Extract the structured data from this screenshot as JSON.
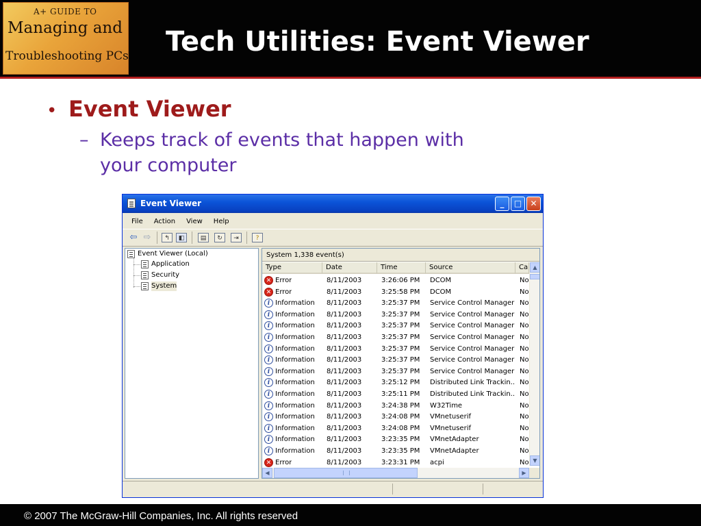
{
  "slide": {
    "title": "Tech Utilities: Event Viewer",
    "logo": {
      "line1": "A+ GUIDE TO",
      "line2": "Managing and",
      "line3": "Troubleshooting PCs"
    },
    "bullet": "Event Viewer",
    "sub_bullet_line1": "Keeps track of events that happen with",
    "sub_bullet_line2": "your computer",
    "footer": "© 2007 The McGraw-Hill Companies, Inc. All rights reserved"
  },
  "window": {
    "title": "Event Viewer",
    "menu": [
      "File",
      "Action",
      "View",
      "Help"
    ],
    "tree": {
      "root": "Event Viewer (Local)",
      "children": [
        "Application",
        "Security",
        "System"
      ]
    },
    "list": {
      "header": "System   1,338 event(s)",
      "columns": [
        "Type",
        "Date",
        "Time",
        "Source",
        "Ca"
      ],
      "rows": [
        {
          "type": "Error",
          "icon": "error-icon",
          "date": "8/11/2003",
          "time": "3:26:06 PM",
          "source": "DCOM",
          "cat": "No"
        },
        {
          "type": "Error",
          "icon": "error-icon",
          "date": "8/11/2003",
          "time": "3:25:58 PM",
          "source": "DCOM",
          "cat": "No"
        },
        {
          "type": "Information",
          "icon": "info-icon",
          "date": "8/11/2003",
          "time": "3:25:37 PM",
          "source": "Service Control Manager",
          "cat": "No"
        },
        {
          "type": "Information",
          "icon": "info-icon",
          "date": "8/11/2003",
          "time": "3:25:37 PM",
          "source": "Service Control Manager",
          "cat": "No"
        },
        {
          "type": "Information",
          "icon": "info-icon",
          "date": "8/11/2003",
          "time": "3:25:37 PM",
          "source": "Service Control Manager",
          "cat": "No"
        },
        {
          "type": "Information",
          "icon": "info-icon",
          "date": "8/11/2003",
          "time": "3:25:37 PM",
          "source": "Service Control Manager",
          "cat": "No"
        },
        {
          "type": "Information",
          "icon": "info-icon",
          "date": "8/11/2003",
          "time": "3:25:37 PM",
          "source": "Service Control Manager",
          "cat": "No"
        },
        {
          "type": "Information",
          "icon": "info-icon",
          "date": "8/11/2003",
          "time": "3:25:37 PM",
          "source": "Service Control Manager",
          "cat": "No"
        },
        {
          "type": "Information",
          "icon": "info-icon",
          "date": "8/11/2003",
          "time": "3:25:37 PM",
          "source": "Service Control Manager",
          "cat": "No"
        },
        {
          "type": "Information",
          "icon": "info-icon",
          "date": "8/11/2003",
          "time": "3:25:12 PM",
          "source": "Distributed Link Trackin...",
          "cat": "No"
        },
        {
          "type": "Information",
          "icon": "info-icon",
          "date": "8/11/2003",
          "time": "3:25:11 PM",
          "source": "Distributed Link Trackin...",
          "cat": "No"
        },
        {
          "type": "Information",
          "icon": "info-icon",
          "date": "8/11/2003",
          "time": "3:24:38 PM",
          "source": "W32Time",
          "cat": "No"
        },
        {
          "type": "Information",
          "icon": "info-icon",
          "date": "8/11/2003",
          "time": "3:24:08 PM",
          "source": "VMnetuserif",
          "cat": "No"
        },
        {
          "type": "Information",
          "icon": "info-icon",
          "date": "8/11/2003",
          "time": "3:24:08 PM",
          "source": "VMnetuserif",
          "cat": "No"
        },
        {
          "type": "Information",
          "icon": "info-icon",
          "date": "8/11/2003",
          "time": "3:23:35 PM",
          "source": "VMnetAdapter",
          "cat": "No"
        },
        {
          "type": "Information",
          "icon": "info-icon",
          "date": "8/11/2003",
          "time": "3:23:35 PM",
          "source": "VMnetAdapter",
          "cat": "No"
        },
        {
          "type": "Error",
          "icon": "error-icon",
          "date": "8/11/2003",
          "time": "3:23:31 PM",
          "source": "acpi",
          "cat": "No"
        }
      ]
    }
  },
  "colors": {
    "title_bar": "#0b54d8",
    "bullet": "#9e1b1b",
    "sub_bullet": "#5b2ea6",
    "header_bg": "#030303"
  }
}
